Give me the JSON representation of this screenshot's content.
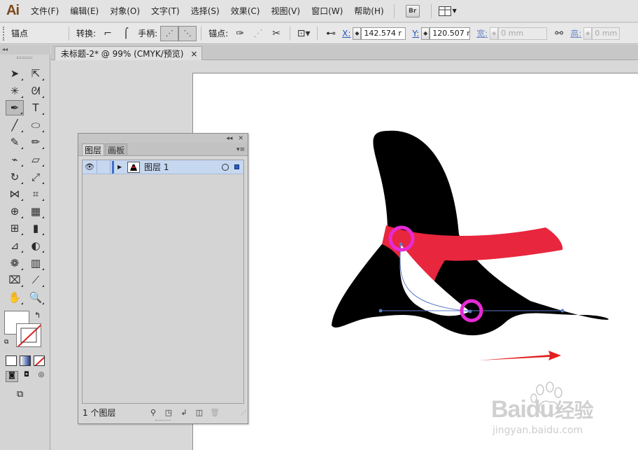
{
  "app": {
    "logo_text": "Ai",
    "menu": [
      "文件(F)",
      "编辑(E)",
      "对象(O)",
      "文字(T)",
      "选择(S)",
      "效果(C)",
      "视图(V)",
      "窗口(W)",
      "帮助(H)"
    ],
    "bridge_badge": "Br"
  },
  "controlbar": {
    "selection_label": "锚点",
    "convert_label": "转换:",
    "handles_label": "手柄:",
    "anchors_label": "锚点:",
    "x_label": "X:",
    "x_value": "142.574 r",
    "y_label": "Y:",
    "y_value": "120.507 r",
    "w_label": "宽:",
    "w_value": "0 mm",
    "h_label": "高:",
    "h_value": "0 mm"
  },
  "document": {
    "tab_title": "未标题-2* @ 99% (CMYK/预览)",
    "close_glyph": "×"
  },
  "tools": [
    {
      "name": "selection-tool",
      "glyph": "➤"
    },
    {
      "name": "direct-selection-tool",
      "glyph": "⇱"
    },
    {
      "name": "magic-wand-tool",
      "glyph": "✳"
    },
    {
      "name": "lasso-tool",
      "glyph": "ᘛ"
    },
    {
      "name": "pen-tool",
      "glyph": "✒"
    },
    {
      "name": "type-tool",
      "glyph": "T"
    },
    {
      "name": "line-tool",
      "glyph": "╱"
    },
    {
      "name": "ellipse-tool",
      "glyph": "⬭"
    },
    {
      "name": "paintbrush-tool",
      "glyph": "✎"
    },
    {
      "name": "pencil-tool",
      "glyph": "✏"
    },
    {
      "name": "blob-brush-tool",
      "glyph": "⌁"
    },
    {
      "name": "eraser-tool",
      "glyph": "▱"
    },
    {
      "name": "rotate-tool",
      "glyph": "↻"
    },
    {
      "name": "scale-tool",
      "glyph": "⤢"
    },
    {
      "name": "width-tool",
      "glyph": "⋈"
    },
    {
      "name": "free-transform-tool",
      "glyph": "⌗"
    },
    {
      "name": "shape-builder-tool",
      "glyph": "⊕"
    },
    {
      "name": "perspective-grid-tool",
      "glyph": "▦"
    },
    {
      "name": "mesh-tool",
      "glyph": "⊞"
    },
    {
      "name": "gradient-tool",
      "glyph": "▮"
    },
    {
      "name": "eyedropper-tool",
      "glyph": "⊿"
    },
    {
      "name": "blend-tool",
      "glyph": "◐"
    },
    {
      "name": "symbol-sprayer-tool",
      "glyph": "❁"
    },
    {
      "name": "column-graph-tool",
      "glyph": "▥"
    },
    {
      "name": "artboard-tool",
      "glyph": "⌧"
    },
    {
      "name": "slice-tool",
      "glyph": "⟋"
    },
    {
      "name": "hand-tool",
      "glyph": "✋"
    },
    {
      "name": "zoom-tool",
      "glyph": "🔍"
    }
  ],
  "layers_panel": {
    "tab_layers": "图层",
    "tab_artboards": "画板",
    "layer_name": "图层 1",
    "footer_count": "1 个图层"
  },
  "artwork": {
    "hat_color": "#000000",
    "band_color": "#e8263d",
    "highlight_color": "#ffffff",
    "marker_color": "#e62ad6",
    "arrow_color": "#e32020",
    "path_color": "#5b7bc9"
  },
  "watermark": {
    "brand": "Baidu",
    "brand_suffix": "经验",
    "url": "jingyan.baidu.com"
  }
}
